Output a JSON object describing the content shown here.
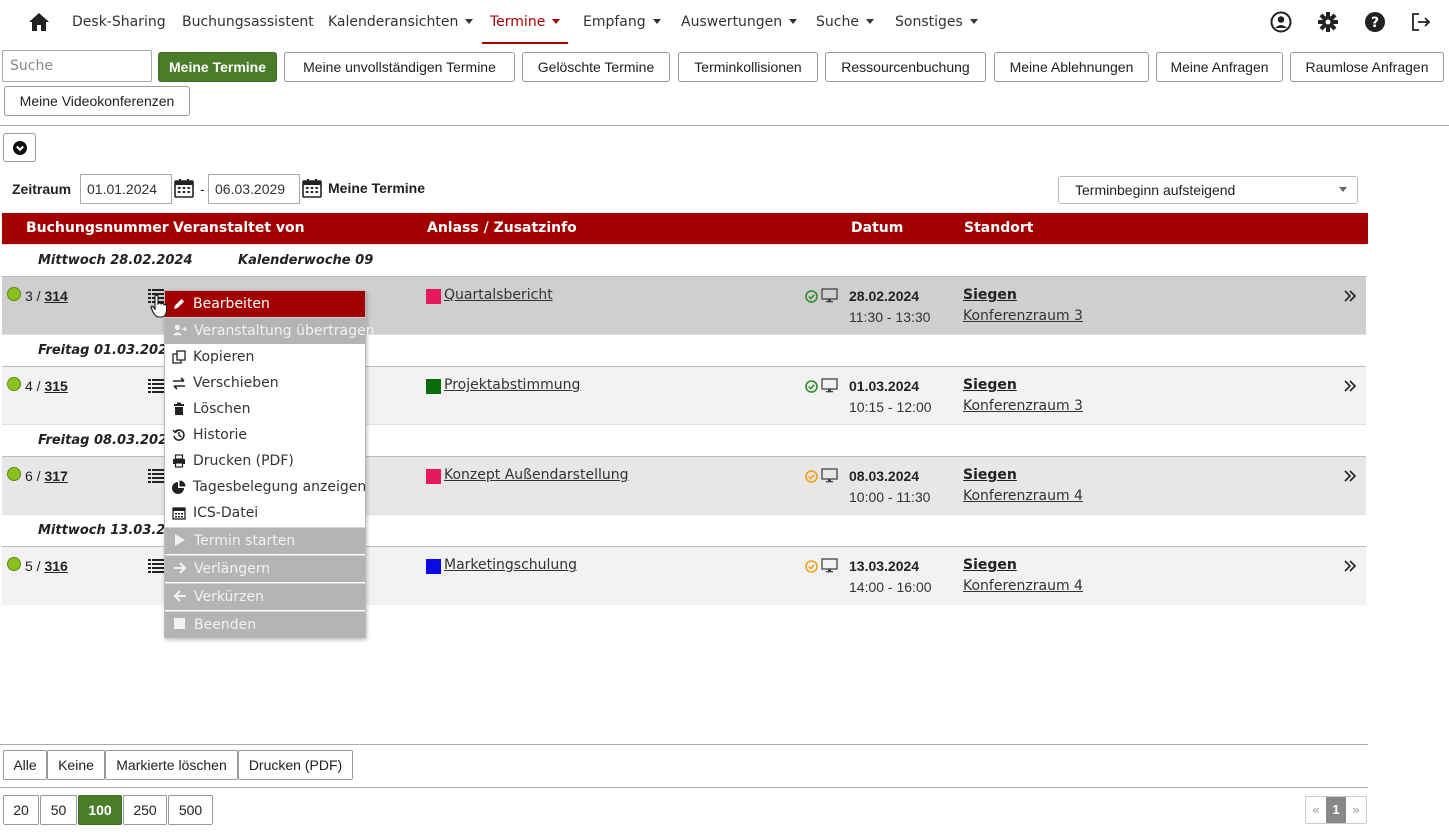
{
  "nav": {
    "items": [
      {
        "label": "Desk-Sharing",
        "caret": false
      },
      {
        "label": "Buchungsassistent",
        "caret": false
      },
      {
        "label": "Kalenderansichten",
        "caret": true
      },
      {
        "label": "Termine",
        "caret": true,
        "active": true
      },
      {
        "label": "Empfang",
        "caret": true
      },
      {
        "label": "Auswertungen",
        "caret": true
      },
      {
        "label": "Suche",
        "caret": true
      },
      {
        "label": "Sonstiges",
        "caret": true
      }
    ]
  },
  "toolbar": {
    "search_placeholder": "Suche",
    "buttons": [
      "Meine Termine",
      "Meine unvollständigen Termine",
      "Gelöschte Termine",
      "Terminkollisionen",
      "Ressourcenbuchung",
      "Meine Ablehnungen",
      "Meine Anfragen",
      "Raumlose Anfragen",
      "Meine Videokonferenzen"
    ]
  },
  "filter": {
    "zeitraum_label": "Zeitraum",
    "date_from": "01.01.2024",
    "separator": "-",
    "date_to": "06.03.2029",
    "view_label": "Meine Termine",
    "sort_selected": "Terminbeginn aufsteigend"
  },
  "table": {
    "headers": [
      "Buchungsnummer",
      "Veranstaltet von",
      "Anlass / Zusatzinfo",
      "Datum",
      "Standort"
    ],
    "groups": [
      {
        "day": "Mittwoch 28.02.2024",
        "week": "Kalenderwoche 09",
        "row": {
          "prefix": "3 / ",
          "number": "314",
          "anlass": "Quartalsbericht",
          "color": "#e8185c",
          "check_color": "#2e8b2e",
          "date": "28.02.2024",
          "time": "11:30 - 13:30",
          "location": "Siegen",
          "room": "Konferenzraum 3"
        }
      },
      {
        "day": "Freitag 01.03.2024",
        "row": {
          "prefix": "4 / ",
          "number": "315",
          "anlass": "Projektabstimmung",
          "color": "#0a6b0a",
          "check_color": "#2e8b2e",
          "date": "01.03.2024",
          "time": "10:15 - 12:00",
          "location": "Siegen",
          "room": "Konferenzraum 3"
        }
      },
      {
        "day": "Freitag 08.03.2024",
        "row": {
          "prefix": "6 / ",
          "number": "317",
          "anlass": "Konzept Außendarstellung",
          "color": "#e8185c",
          "check_color": "#f0a020",
          "date": "08.03.2024",
          "time": "10:00 - 11:30",
          "location": "Siegen",
          "room": "Konferenzraum 4"
        }
      },
      {
        "day": "Mittwoch 13.03.2024",
        "row": {
          "prefix": "5 / ",
          "number": "316",
          "anlass": "Marketingschulung",
          "color": "#0a0ae6",
          "check_color": "#f0a020",
          "date": "13.03.2024",
          "time": "14:00 - 16:00",
          "location": "Siegen",
          "room": "Konferenzraum 4"
        }
      }
    ]
  },
  "context_menu": {
    "items": [
      {
        "label": "Bearbeiten",
        "icon": "pencil-icon",
        "state": "active"
      },
      {
        "label": "Veranstaltung übertragen",
        "icon": "user-transfer-icon",
        "state": "disabled"
      },
      {
        "label": "Kopieren",
        "icon": "copy-icon",
        "state": "normal"
      },
      {
        "label": "Verschieben",
        "icon": "arrows-exchange-icon",
        "state": "normal"
      },
      {
        "label": "Löschen",
        "icon": "trash-icon",
        "state": "normal"
      },
      {
        "label": "Historie",
        "icon": "history-icon",
        "state": "normal"
      },
      {
        "label": "Drucken (PDF)",
        "icon": "printer-icon",
        "state": "normal"
      },
      {
        "label": "Tagesbelegung anzeigen",
        "icon": "pie-chart-icon",
        "state": "normal"
      },
      {
        "label": "ICS-Datei",
        "icon": "calendar-icon",
        "state": "normal"
      },
      {
        "label": "Termin starten",
        "icon": "play-icon",
        "state": "disabled"
      },
      {
        "label": "Verlängern",
        "icon": "arrow-right-icon",
        "state": "disabled"
      },
      {
        "label": "Verkürzen",
        "icon": "arrow-left-icon",
        "state": "disabled"
      },
      {
        "label": "Beenden",
        "icon": "stop-icon",
        "state": "disabled"
      }
    ]
  },
  "footer": {
    "actions": [
      "Alle",
      "Keine",
      "Markierte löschen",
      "Drucken (PDF)"
    ],
    "page_sizes": [
      "20",
      "50",
      "100",
      "250",
      "500"
    ],
    "page_size_selected": "100",
    "pager": {
      "prev": "«",
      "current": "1",
      "next": "»"
    }
  },
  "colors": {
    "brand": "#a20000",
    "primary_green": "#4a7d2a"
  }
}
